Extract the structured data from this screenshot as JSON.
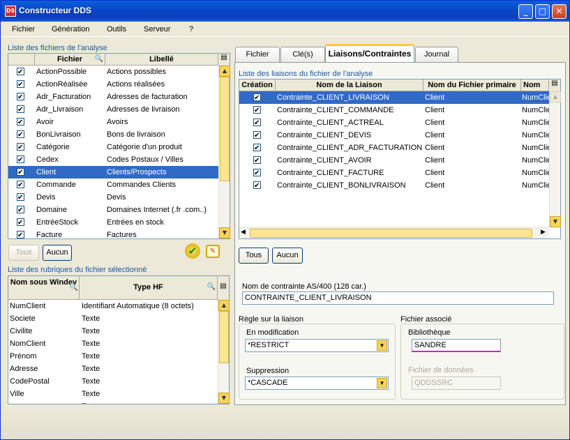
{
  "window": {
    "title": "Constructeur DDS",
    "app_icon": "DS"
  },
  "menu": [
    "Fichier",
    "Génération",
    "Outils",
    "Serveur",
    "?"
  ],
  "files_section": {
    "label": "Liste des fichiers de l'analyse",
    "col_file": "Fichier",
    "col_label": "Libellé",
    "rows": [
      {
        "file": "ActionPossible",
        "label": "Actions possibles"
      },
      {
        "file": "ActionRéalisée",
        "label": "Actions réalisées"
      },
      {
        "file": "Adr_Facturation",
        "label": "Adresses de facturation"
      },
      {
        "file": "Adr_Livraison",
        "label": "Adresses de livraison"
      },
      {
        "file": "Avoir",
        "label": "Avoirs"
      },
      {
        "file": "BonLivraison",
        "label": "Bons de livraison"
      },
      {
        "file": "Catégorie",
        "label": "Catégorie d'un produit"
      },
      {
        "file": "Cedex",
        "label": "Codes Postaux / Villes"
      },
      {
        "file": "Client",
        "label": "Clients/Prospects"
      },
      {
        "file": "Commande",
        "label": "Commandes Clients"
      },
      {
        "file": "Devis",
        "label": "Devis"
      },
      {
        "file": "Domaine",
        "label": "Domaines Internet (.fr .com..)"
      },
      {
        "file": "EntréeStock",
        "label": "Entrées en stock"
      },
      {
        "file": "Facture",
        "label": "Factures"
      }
    ],
    "selected_index": 8,
    "btn_all": "Tous",
    "btn_none": "Aucun"
  },
  "fields_section": {
    "label": "Liste des rubriques du fichier sélectionné",
    "col_name": "Nom sous Windev",
    "col_type": "Type HF",
    "rows": [
      {
        "name": "NumClient",
        "type": "Identifiant Automatique (8 octets)"
      },
      {
        "name": "Societe",
        "type": "Texte"
      },
      {
        "name": "Civilite",
        "type": "Texte"
      },
      {
        "name": "NomClient",
        "type": "Texte"
      },
      {
        "name": "Prénom",
        "type": "Texte"
      },
      {
        "name": "Adresse",
        "type": "Texte"
      },
      {
        "name": "CodePostal",
        "type": "Texte"
      },
      {
        "name": "Ville",
        "type": "Texte"
      },
      {
        "name": "",
        "type": "Texte"
      }
    ]
  },
  "tabs": [
    "Fichier",
    "Clé(s)",
    "Liaisons/Contraintes",
    "Journal"
  ],
  "links_section": {
    "label": "Liste des liaisons du fichier de l'analyse",
    "col_create": "Création",
    "col_name": "Nom de la Liaison",
    "col_primary": "Nom du Fichier primaire",
    "col_secondary": "Nom de",
    "rows": [
      {
        "name": "Contrainte_CLIENT_LIVRAISON",
        "primary": "Client",
        "secondary": "NumClie"
      },
      {
        "name": "Contrainte_CLIENT_COMMANDE",
        "primary": "Client",
        "secondary": "NumClie"
      },
      {
        "name": "Contrainte_CLIENT_ACTREAL",
        "primary": "Client",
        "secondary": "NumClie"
      },
      {
        "name": "Contrainte_CLIENT_DEVIS",
        "primary": "Client",
        "secondary": "NumClie"
      },
      {
        "name": "Contrainte_CLIENT_ADR_FACTURATION",
        "primary": "Client",
        "secondary": "NumClie"
      },
      {
        "name": "Contrainte_CLIENT_AVOIR",
        "primary": "Client",
        "secondary": "NumClie"
      },
      {
        "name": "Contrainte_CLIENT_FACTURE",
        "primary": "Client",
        "secondary": "NumClie"
      },
      {
        "name": "Contrainte_CLIENT_BONLIVRAISON",
        "primary": "Client",
        "secondary": "NumClie"
      }
    ],
    "btn_all": "Tous",
    "btn_none": "Aucun"
  },
  "constraint": {
    "label": "Nom de contrainte AS/400 (128 car.)",
    "value": "CONTRAINTE_CLIENT_LIVRAISON"
  },
  "rule": {
    "group": "Règle sur la liaison",
    "modif_label": "En modification",
    "modif_value": "*RESTRICT",
    "delete_label": "Suppression",
    "delete_value": "*CASCADE"
  },
  "assoc": {
    "group": "Fichier associé",
    "lib_label": "Bibliothèque",
    "lib_value": "SANDRE",
    "data_label": "Fichier de données",
    "data_value": "QDDSSRC"
  },
  "colors": {
    "selection": "#316ac5",
    "group_label": "#1a5aa6",
    "lib_underline": "#d01fd0"
  }
}
